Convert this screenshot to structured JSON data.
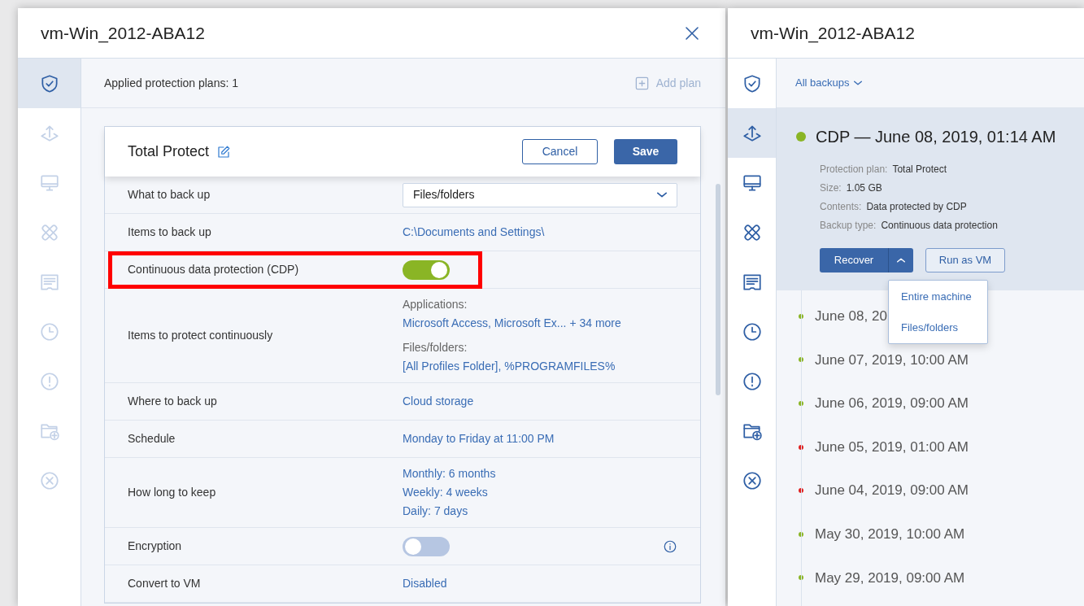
{
  "left_panel": {
    "title": "vm-Win_2012-ABA12",
    "sidebar": [
      {
        "kind": "shield",
        "selected": true,
        "disabled": false
      },
      {
        "kind": "upload",
        "selected": false,
        "disabled": true
      },
      {
        "kind": "monitor",
        "selected": false,
        "disabled": true
      },
      {
        "kind": "bandage",
        "selected": false,
        "disabled": true
      },
      {
        "kind": "receipt",
        "selected": false,
        "disabled": true
      },
      {
        "kind": "clock",
        "selected": false,
        "disabled": true
      },
      {
        "kind": "alert",
        "selected": false,
        "disabled": true
      },
      {
        "kind": "folder",
        "selected": false,
        "disabled": true
      },
      {
        "kind": "cancel",
        "selected": false,
        "disabled": true
      }
    ],
    "plans_label": "Applied protection plans: 1",
    "add_plan": {
      "label": "Add plan",
      "disabled": true
    },
    "plan": {
      "name": "Total Protect",
      "cancel": "Cancel",
      "save": "Save",
      "rows": [
        {
          "kind": "select",
          "label": "What to back up",
          "value": "Files/folders",
          "highlighted": false
        },
        {
          "kind": "link",
          "label": "Items to back up",
          "value": "C:\\Documents and Settings\\",
          "highlighted": false
        },
        {
          "kind": "toggle",
          "label": "Continuous data protection (CDP)",
          "on": true,
          "info": false,
          "highlighted": true
        },
        {
          "kind": "groups",
          "label": "Items to protect continuously",
          "groups": [
            {
              "heading": "Applications:",
              "value": "Microsoft Access, Microsoft Ex... + 34 more"
            },
            {
              "heading": "Files/folders:",
              "value": "[All Profiles Folder], %PROGRAMFILES%"
            }
          ],
          "highlighted": false
        },
        {
          "kind": "link",
          "label": "Where to back up",
          "value": "Cloud storage",
          "highlighted": false
        },
        {
          "kind": "link",
          "label": "Schedule",
          "value": "Monday to Friday at 11:00 PM",
          "highlighted": false
        },
        {
          "kind": "lines",
          "label": "How long to keep",
          "lines": [
            "Monthly: 6 months",
            "Weekly: 4 weeks",
            "Daily: 7 days"
          ],
          "highlighted": false
        },
        {
          "kind": "toggle",
          "label": "Encryption",
          "on": false,
          "info": true,
          "highlighted": false
        },
        {
          "kind": "link",
          "label": "Convert to VM",
          "value": "Disabled",
          "highlighted": false
        }
      ]
    }
  },
  "right_panel": {
    "title": "vm-Win_2012-ABA12",
    "sidebar": [
      {
        "kind": "shield",
        "selected": false,
        "disabled": false
      },
      {
        "kind": "upload",
        "selected": true,
        "disabled": false
      },
      {
        "kind": "monitor",
        "selected": false,
        "disabled": false
      },
      {
        "kind": "bandage",
        "selected": false,
        "disabled": false
      },
      {
        "kind": "receipt",
        "selected": false,
        "disabled": false
      },
      {
        "kind": "clock",
        "selected": false,
        "disabled": false
      },
      {
        "kind": "alert",
        "selected": false,
        "disabled": false
      },
      {
        "kind": "folder",
        "selected": false,
        "disabled": false
      },
      {
        "kind": "cancel",
        "selected": false,
        "disabled": false
      }
    ],
    "filter": "All backups",
    "selected_backup": {
      "title": "CDP — June 08, 2019, 01:14 AM",
      "color": "#8ab525",
      "details": [
        {
          "label": "Protection plan:",
          "value": "Total Protect"
        },
        {
          "label": "Size:",
          "value": "1.05 GB"
        },
        {
          "label": "Contents:",
          "value": "Data protected by CDP"
        },
        {
          "label": "Backup type:",
          "value": "Continuous data protection"
        }
      ],
      "recover": "Recover",
      "run_as_vm": "Run as VM",
      "menu": [
        "Entire machine",
        "Files/folders"
      ]
    },
    "backups": [
      {
        "label": "June 08, 20",
        "color": "#8ab525"
      },
      {
        "label": "June 07, 2019, 10:00 AM",
        "color": "#8ab525"
      },
      {
        "label": "June 06, 2019, 09:00 AM",
        "color": "#8ab525"
      },
      {
        "label": "June 05, 2019, 01:00 AM",
        "color": "#e02020"
      },
      {
        "label": "June 04, 2019, 09:00 AM",
        "color": "#e02020"
      },
      {
        "label": "May 30, 2019, 10:00 AM",
        "color": "#8ab525"
      },
      {
        "label": "May 29, 2019, 09:00 AM",
        "color": "#8ab525"
      }
    ]
  }
}
